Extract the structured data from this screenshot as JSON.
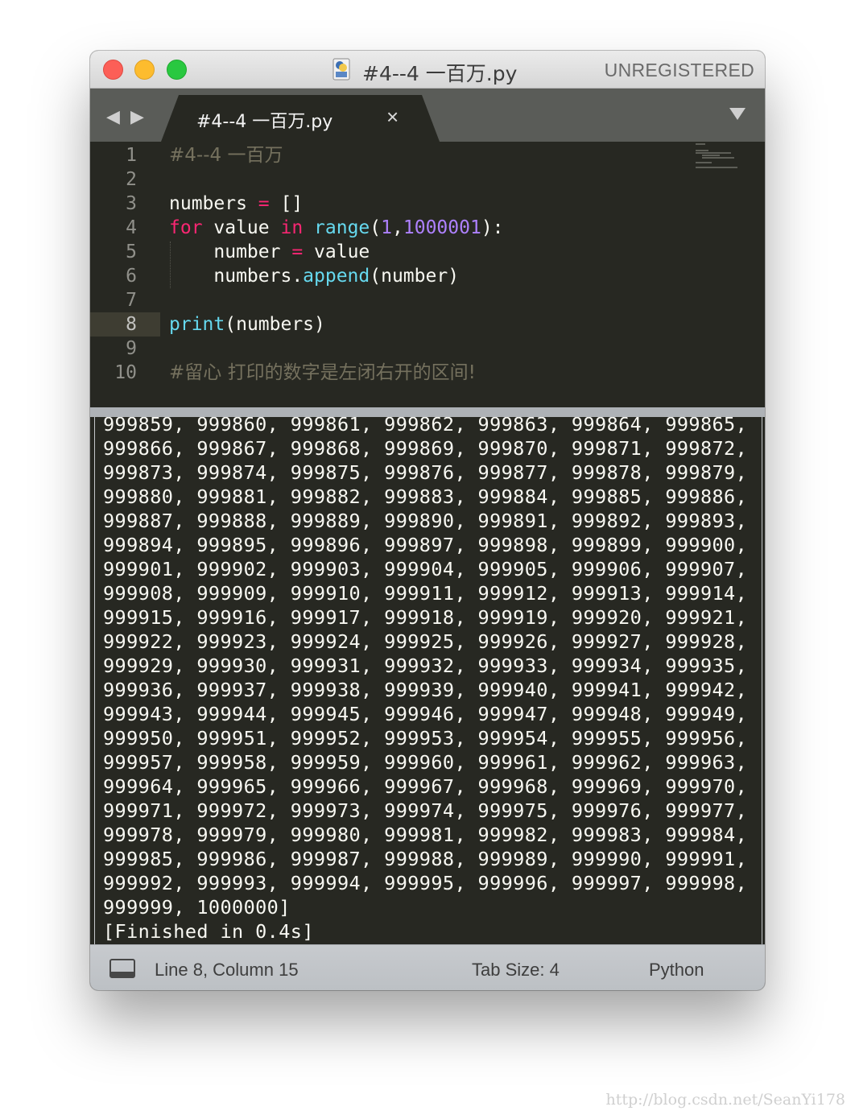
{
  "window": {
    "title": "#4--4 一百万.py",
    "registration": "UNREGISTERED"
  },
  "tabs": [
    {
      "label": "#4--4 一百万.py",
      "close_glyph": "×"
    }
  ],
  "nav": {
    "back_glyph": "◀",
    "forward_glyph": "▶"
  },
  "editor": {
    "line_numbers": [
      "1",
      "2",
      "3",
      "4",
      "5",
      "6",
      "7",
      "8",
      "9",
      "10"
    ],
    "current_line": 8,
    "lines": [
      [
        {
          "t": "#4--4 一百万",
          "c": "cmt"
        }
      ],
      [],
      [
        {
          "t": "numbers ",
          "c": ""
        },
        {
          "t": "=",
          "c": "kw"
        },
        {
          "t": " []",
          "c": ""
        }
      ],
      [
        {
          "t": "for",
          "c": "kw"
        },
        {
          "t": " value ",
          "c": ""
        },
        {
          "t": "in",
          "c": "kw"
        },
        {
          "t": " ",
          "c": ""
        },
        {
          "t": "range",
          "c": "fn"
        },
        {
          "t": "(",
          "c": ""
        },
        {
          "t": "1",
          "c": "num"
        },
        {
          "t": ",",
          "c": ""
        },
        {
          "t": "1000001",
          "c": "num"
        },
        {
          "t": "):",
          "c": ""
        }
      ],
      [
        {
          "t": "    number ",
          "c": ""
        },
        {
          "t": "=",
          "c": "kw"
        },
        {
          "t": " value",
          "c": ""
        }
      ],
      [
        {
          "t": "    numbers.",
          "c": ""
        },
        {
          "t": "append",
          "c": "fn"
        },
        {
          "t": "(number)",
          "c": ""
        }
      ],
      [],
      [
        {
          "t": "print",
          "c": "fn"
        },
        {
          "t": "(numbers)",
          "c": ""
        }
      ],
      [],
      [
        {
          "t": "#留心 打印的数字是左闭右开的区间!",
          "c": "cmt"
        }
      ]
    ]
  },
  "output": {
    "lines": [
      "999859, 999860, 999861, 999862, 999863, 999864, 999865,",
      "999866, 999867, 999868, 999869, 999870, 999871, 999872,",
      "999873, 999874, 999875, 999876, 999877, 999878, 999879,",
      "999880, 999881, 999882, 999883, 999884, 999885, 999886,",
      "999887, 999888, 999889, 999890, 999891, 999892, 999893,",
      "999894, 999895, 999896, 999897, 999898, 999899, 999900,",
      "999901, 999902, 999903, 999904, 999905, 999906, 999907,",
      "999908, 999909, 999910, 999911, 999912, 999913, 999914,",
      "999915, 999916, 999917, 999918, 999919, 999920, 999921,",
      "999922, 999923, 999924, 999925, 999926, 999927, 999928,",
      "999929, 999930, 999931, 999932, 999933, 999934, 999935,",
      "999936, 999937, 999938, 999939, 999940, 999941, 999942,",
      "999943, 999944, 999945, 999946, 999947, 999948, 999949,",
      "999950, 999951, 999952, 999953, 999954, 999955, 999956,",
      "999957, 999958, 999959, 999960, 999961, 999962, 999963,",
      "999964, 999965, 999966, 999967, 999968, 999969, 999970,",
      "999971, 999972, 999973, 999974, 999975, 999976, 999977,",
      "999978, 999979, 999980, 999981, 999982, 999983, 999984,",
      "999985, 999986, 999987, 999988, 999989, 999990, 999991,",
      "999992, 999993, 999994, 999995, 999996, 999997, 999998,",
      "999999, 1000000]",
      "[Finished in 0.4s]"
    ]
  },
  "statusbar": {
    "position": "Line 8, Column 15",
    "tab_size": "Tab Size: 4",
    "syntax": "Python"
  },
  "watermark": "http://blog.csdn.net/SeanYi178",
  "colors": {
    "background": "#272822",
    "comment": "#75715e",
    "keyword": "#f92672",
    "function": "#66d9ef",
    "number": "#ae81ff",
    "text": "#f8f8f2"
  }
}
